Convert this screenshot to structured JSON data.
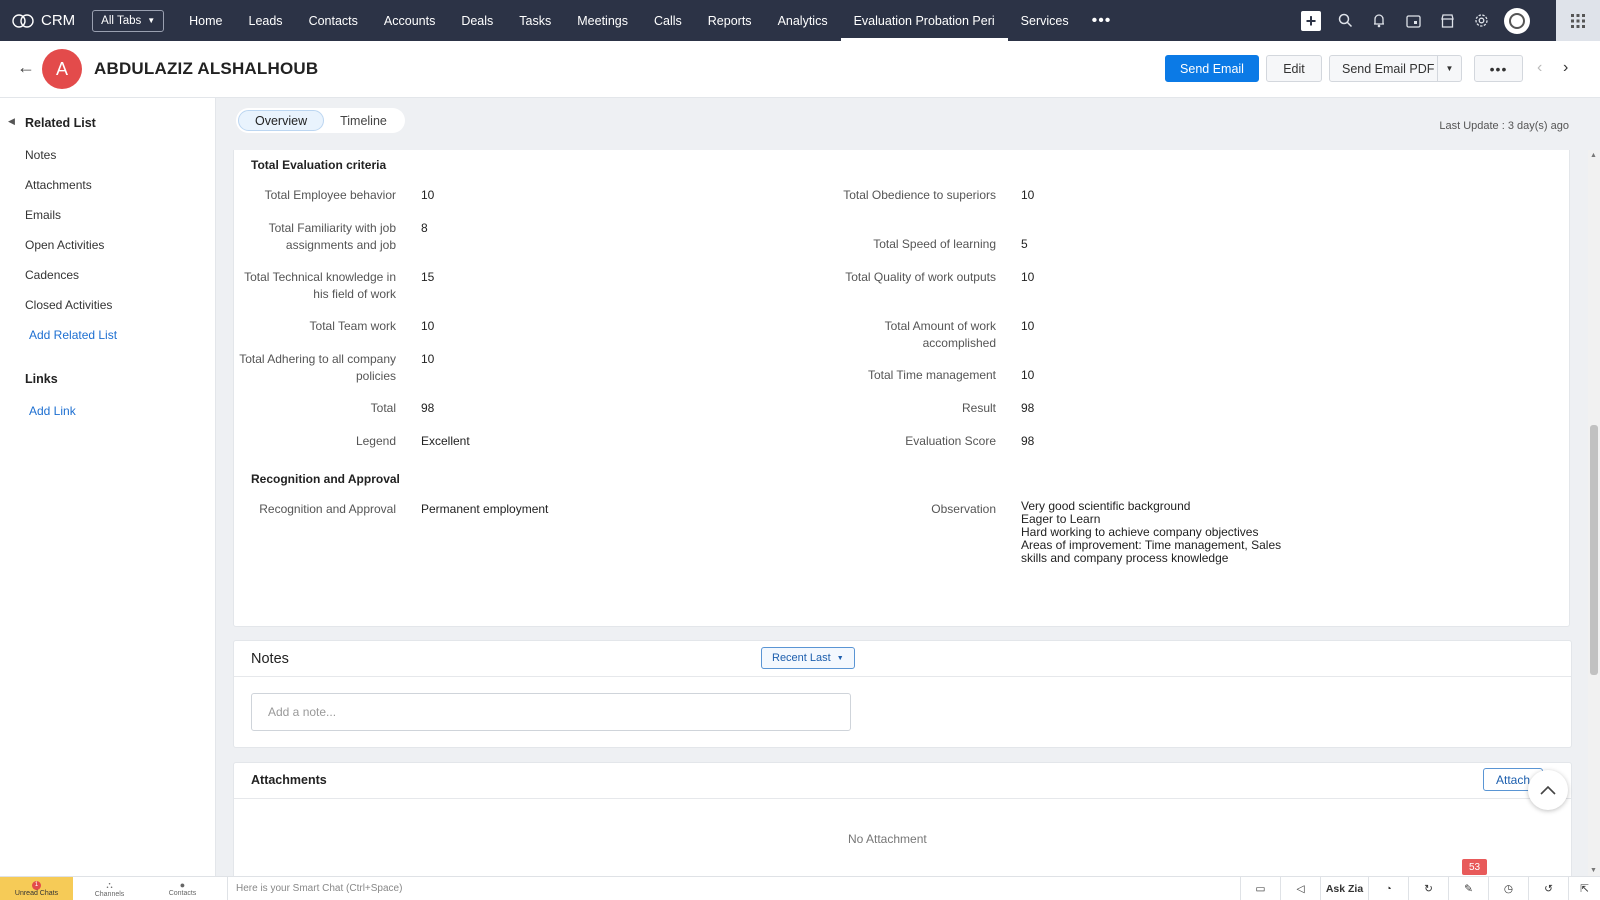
{
  "nav": {
    "brand": "CRM",
    "all_tabs": "All Tabs",
    "tabs": [
      "Home",
      "Leads",
      "Contacts",
      "Accounts",
      "Deals",
      "Tasks",
      "Meetings",
      "Calls",
      "Reports",
      "Analytics",
      "Evaluation Probation Peri",
      "Services"
    ],
    "active_tab": "Evaluation Probation Peri"
  },
  "record": {
    "avatar_letter": "A",
    "name": "ABDULAZIZ ALSHALHOUB",
    "send_email": "Send Email",
    "edit": "Edit",
    "send_email_pdf": "Send Email PDF"
  },
  "sidebar": {
    "related_title": "Related List",
    "items": [
      "Notes",
      "Attachments",
      "Emails",
      "Open Activities",
      "Cadences",
      "Closed Activities"
    ],
    "add_related": "Add Related List",
    "links_title": "Links",
    "add_link": "Add Link"
  },
  "view_tabs": {
    "overview": "Overview",
    "timeline": "Timeline"
  },
  "last_update": "Last Update : 3 day(s) ago",
  "evaluation": {
    "section_title": "Total Evaluation criteria",
    "left": [
      {
        "label": "Total Employee behavior",
        "value": "10"
      },
      {
        "label": "Total Familiarity with job assignments and job",
        "value": "8"
      },
      {
        "label": "Total Technical knowledge in his field of work",
        "value": "15"
      },
      {
        "label": "Total Team work",
        "value": "10"
      },
      {
        "label": "Total Adhering to all company policies",
        "value": "10"
      },
      {
        "label": "Total",
        "value": "98"
      },
      {
        "label": "Legend",
        "value": "Excellent"
      }
    ],
    "right": [
      {
        "label": "Total Obedience to superiors",
        "value": "10"
      },
      {
        "label": "Total Speed of learning",
        "value": "5"
      },
      {
        "label": "Total Quality of work outputs",
        "value": "10"
      },
      {
        "label": "Total Amount of work accomplished",
        "value": "10"
      },
      {
        "label": "Total Time management",
        "value": "10"
      },
      {
        "label": "Result",
        "value": "98"
      },
      {
        "label": "Evaluation Score",
        "value": "98"
      }
    ]
  },
  "recognition": {
    "section_title": "Recognition and Approval",
    "label": "Recognition and Approval",
    "value": "Permanent employment",
    "observation_label": "Observation",
    "observation_lines": [
      "Very good scientific background",
      "Eager to Learn",
      "Hard working to achieve company objectives",
      "Areas of improvement: Time management, Sales",
      "skills and company process knowledge"
    ]
  },
  "notes": {
    "title": "Notes",
    "sort": "Recent Last",
    "placeholder": "Add a note..."
  },
  "attachments": {
    "title": "Attachments",
    "attach_button": "Attach",
    "empty": "No Attachment"
  },
  "bottom_bar": {
    "unread_chats": "Unread Chats",
    "unread_count": "1",
    "channels": "Channels",
    "contacts": "Contacts",
    "smart_chat": "Here is your Smart Chat (Ctrl+Space)",
    "ask_zia": "Ask Zia",
    "notification_count": "53"
  },
  "colors": {
    "nav_bg": "#2c3346",
    "primary": "#0b7ae6",
    "avatar": "#e34b4b",
    "link": "#1d6fd1"
  }
}
